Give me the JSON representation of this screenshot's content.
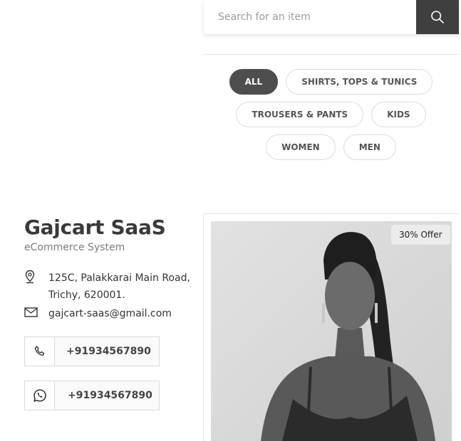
{
  "search": {
    "placeholder": "Search for an item",
    "icon": "search-icon"
  },
  "filters": {
    "rows": [
      [
        "ALL",
        "SHIRTS, TOPS & TUNICS"
      ],
      [
        "TROUSERS & PANTS",
        "KIDS"
      ],
      [
        "WOMEN",
        "MEN"
      ]
    ],
    "active": "ALL"
  },
  "store": {
    "name": "Gajcart SaaS",
    "tagline": "eCommerce System",
    "address_line1": "125C, Palakkarai Main Road,",
    "address_line2": "Trichy, 620001.",
    "email": "gajcart-saas@gmail.com",
    "phone": "+91934567890",
    "whatsapp": "+91934567890"
  },
  "product": {
    "badge": "30% Offer"
  },
  "colors": {
    "accent_dark": "#4e4e4e",
    "search_button": "#3f3f3f"
  }
}
